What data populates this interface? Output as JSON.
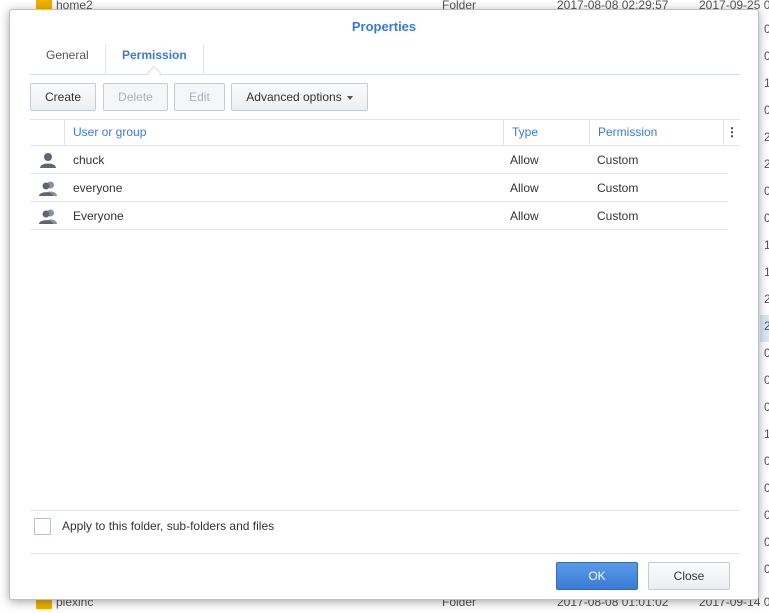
{
  "background": {
    "top_row": {
      "name": "home2",
      "type": "Folder",
      "created": "2017-08-08 02:29:57",
      "modified": "2017-09-25 0"
    },
    "bottom_row": {
      "name": "plexinc",
      "type": "Folder",
      "created": "2017-08-08 01:01:02",
      "modified": "2017-09-14 0"
    },
    "edge_chars": [
      "0",
      "0",
      "1",
      "0",
      "2",
      "2",
      "0",
      "0",
      "1",
      "1",
      "2",
      "2",
      "0",
      "0",
      "0",
      "1",
      "0",
      "0",
      "0",
      "0",
      "0",
      "2"
    ]
  },
  "dialog": {
    "title": "Properties",
    "tabs": [
      {
        "label": "General"
      },
      {
        "label": "Permission"
      }
    ],
    "active_tab": "Permission",
    "toolbar": {
      "create_label": "Create",
      "delete_label": "Delete",
      "edit_label": "Edit",
      "advanced_label": "Advanced options"
    },
    "grid": {
      "columns": {
        "user": "User or group",
        "type": "Type",
        "permission": "Permission",
        "more": "⋮"
      },
      "rows": [
        {
          "icon": "user-icon",
          "user": "chuck",
          "type": "Allow",
          "permission": "Custom"
        },
        {
          "icon": "group-icon",
          "user": "everyone",
          "type": "Allow",
          "permission": "Custom"
        },
        {
          "icon": "group-icon",
          "user": "Everyone",
          "type": "Allow",
          "permission": "Custom"
        }
      ]
    },
    "apply_label": "Apply to this folder, sub-folders and files",
    "ok_label": "OK",
    "close_label": "Close"
  },
  "colors": {
    "accent": "#3a7bd5",
    "folder": "#f0b000",
    "selected_row": "#dbe8f7"
  }
}
